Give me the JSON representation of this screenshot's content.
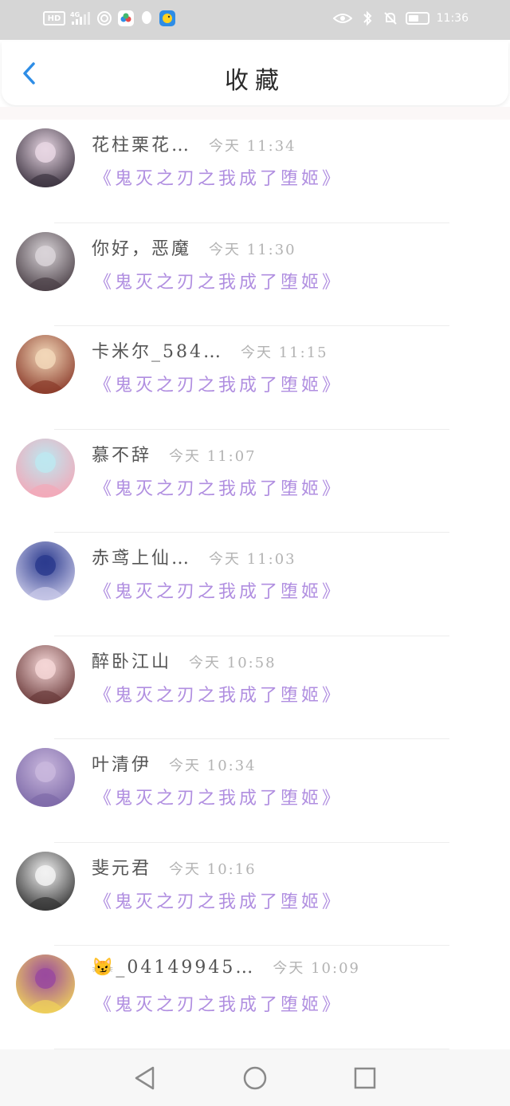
{
  "status_bar": {
    "left_chips": [
      "HD",
      "4G"
    ],
    "time": "11:36",
    "icons": [
      "hd-icon",
      "signal-icon",
      "wifi-icon",
      "cloud-app-icon",
      "qq-icon",
      "bird-app-icon"
    ],
    "right_icons": [
      "eye-icon",
      "bluetooth-icon",
      "mute-bell-icon",
      "battery-icon"
    ]
  },
  "header": {
    "title": "收藏",
    "back_icon": "chevron-left-icon",
    "accent_color": "#2e8de6"
  },
  "list": {
    "book_color": "#b08ee0",
    "items": [
      {
        "name": "花柱栗花…",
        "time": "今天 11:34",
        "book": "《鬼灭之刃之我成了堕姬》",
        "avatar_colors": [
          "#e7d6e3",
          "#3c3340"
        ]
      },
      {
        "name": "你好，恶魔",
        "time": "今天 11:30",
        "book": "《鬼灭之刃之我成了堕姬》",
        "avatar_colors": [
          "#d9d4d8",
          "#4a3f46"
        ]
      },
      {
        "name": "卡米尔_584…",
        "time": "今天 11:15",
        "book": "《鬼灭之刃之我成了堕姬》",
        "avatar_colors": [
          "#f2d7b8",
          "#8a3a2a"
        ]
      },
      {
        "name": "慕不辞",
        "time": "今天 11:07",
        "book": "《鬼灭之刃之我成了堕姬》",
        "avatar_colors": [
          "#bde7f0",
          "#f3a8b8"
        ]
      },
      {
        "name": "赤鸢上仙…",
        "time": "今天 11:03",
        "book": "《鬼灭之刃之我成了堕姬》",
        "avatar_colors": [
          "#2c3b8e",
          "#c9c9e8"
        ]
      },
      {
        "name": "醉卧江山",
        "time": "今天 10:58",
        "book": "《鬼灭之刃之我成了堕姬》",
        "avatar_colors": [
          "#f4d6d6",
          "#6a3a3a"
        ]
      },
      {
        "name": "叶清伊",
        "time": "今天 10:34",
        "book": "《鬼灭之刃之我成了堕姬》",
        "avatar_colors": [
          "#c9b7dd",
          "#7d6aa8"
        ]
      },
      {
        "name": "斐元君",
        "time": "今天 10:16",
        "book": "《鬼灭之刃之我成了堕姬》",
        "avatar_colors": [
          "#f2f2f2",
          "#333333"
        ]
      },
      {
        "name": "😼_04149945…",
        "time": "今天 10:09",
        "book": "《鬼灭之刃之我成了堕姬》",
        "avatar_colors": [
          "#9a4a9e",
          "#f0d25a"
        ]
      }
    ]
  },
  "nav_bar": {
    "buttons": [
      "back-triangle-icon",
      "home-circle-icon",
      "recents-square-icon"
    ]
  }
}
